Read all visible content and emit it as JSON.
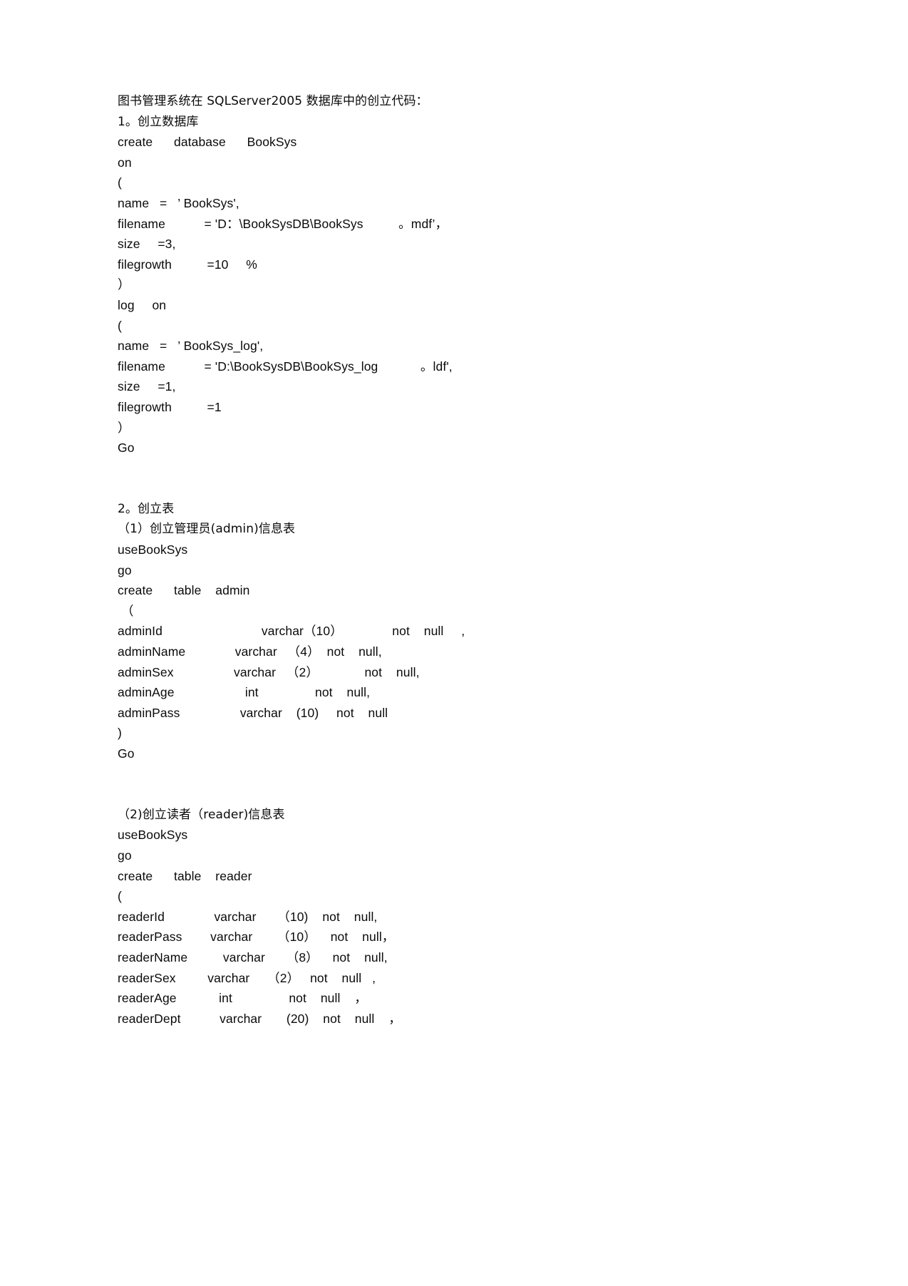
{
  "document": {
    "title_line": "图书管理系统在 SQLServer2005 数据库中的创立代码：",
    "sections": [
      {
        "heading": "1。创立数据库",
        "lines": [
          "create      database      BookSys",
          "on",
          "(",
          "name   =   ’ BookSys',",
          "filename           = 'D：\\BookSysDB\\BookSys          。mdf’，",
          "size     =3,",
          "filegrowth          =10     %",
          "）",
          "log     on",
          "(",
          "name   =   ’ BookSys_log',",
          "filename           = 'D:\\BookSysDB\\BookSys_log            。ldf',",
          "size     =1,",
          "filegrowth          =1",
          "）",
          "Go"
        ]
      },
      {
        "heading": "2。创立表",
        "subsections": [
          {
            "label": "（1）创立管理员(admin)信息表",
            "lines": [
              "useBookSys",
              "go",
              "create      table    admin",
              " （",
              "adminId                            varchar（10）              not    null     ,",
              "adminName              varchar   （4）  not    null,",
              "adminSex                 varchar   （2）             not    null,",
              "adminAge                    int                not    null,",
              "adminPass                 varchar    (10)     not    null",
              ")",
              "Go"
            ]
          },
          {
            "label": "（2)创立读者（reader)信息表",
            "lines": [
              "useBookSys",
              "go",
              "create      table    reader",
              "(",
              "readerId              varchar      （10)    not    null,",
              "readerPass        varchar       （10）    not    null，",
              "readerName          varchar      （8）    not    null,",
              "readerSex         varchar     （2）   not    null   ,",
              "readerAge            int                not    null    ，",
              "readerDept           varchar       (20)    not    null    ，"
            ]
          }
        ]
      }
    ]
  }
}
